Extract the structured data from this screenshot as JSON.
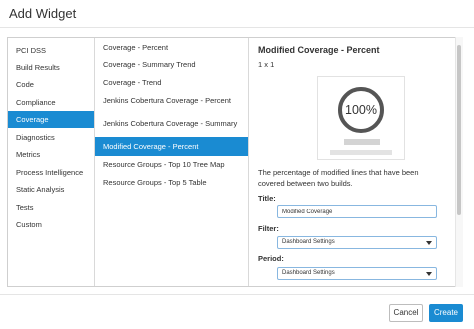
{
  "dialog": {
    "title": "Add Widget"
  },
  "categories": {
    "items": [
      {
        "label": "PCI DSS"
      },
      {
        "label": "Build Results"
      },
      {
        "label": "Code"
      },
      {
        "label": "Compliance"
      },
      {
        "label": "Coverage",
        "selected": true
      },
      {
        "label": "Diagnostics"
      },
      {
        "label": "Metrics"
      },
      {
        "label": "Process Intelligence"
      },
      {
        "label": "Static Analysis"
      },
      {
        "label": "Tests"
      },
      {
        "label": "Custom"
      }
    ]
  },
  "widgets": {
    "items": [
      {
        "label": "Coverage - Percent"
      },
      {
        "label": "Coverage - Summary Trend"
      },
      {
        "label": "Coverage - Trend"
      },
      {
        "label": "Jenkins Cobertura Coverage - Percent"
      },
      {
        "label": "Jenkins Cobertura Coverage - Summary"
      },
      {
        "label": "Modified Coverage - Percent",
        "selected": true
      },
      {
        "label": "Resource Groups - Top 10 Tree Map"
      },
      {
        "label": "Resource Groups - Top 5 Table"
      }
    ]
  },
  "detail": {
    "title": "Modified Coverage - Percent",
    "size": "1 x 1",
    "preview_value": "100%",
    "description": "The percentage of modified lines that have been covered between two builds.",
    "title_label": "Title:",
    "title_value": "Modified Coverage",
    "filter_label": "Filter:",
    "filter_value": "Dashboard Settings",
    "period_label": "Period:",
    "period_value": "Dashboard Settings"
  },
  "footer": {
    "cancel_label": "Cancel",
    "create_label": "Create"
  },
  "colors": {
    "accent": "#1a8bd2",
    "border": "#cfcfcf"
  }
}
